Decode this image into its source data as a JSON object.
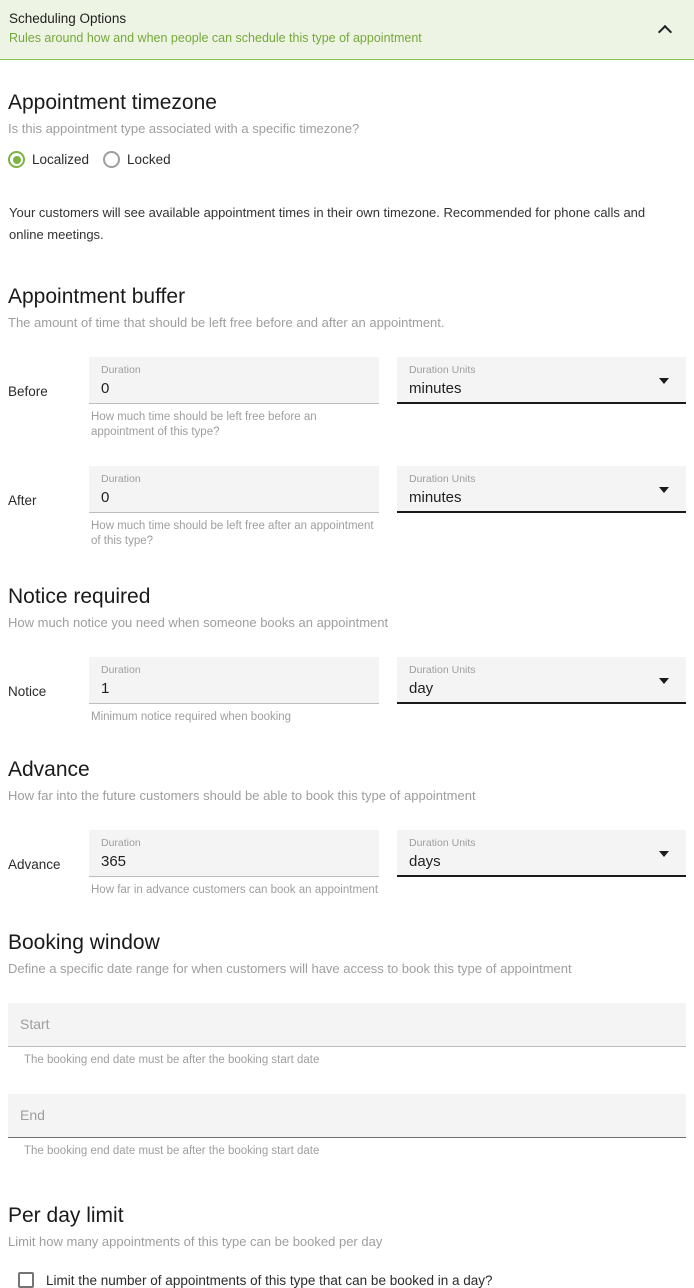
{
  "panel": {
    "title": "Scheduling Options",
    "subtitle": "Rules around how and when people can schedule this type of appointment",
    "collapse_icon": "chevron-up-icon",
    "accent_color": "#8bc34a",
    "header_bg": "#edf4e3",
    "subtitle_color": "#76a83c"
  },
  "timezone": {
    "title": "Appointment timezone",
    "description": "Is this appointment type associated with a specific timezone?",
    "options": [
      {
        "label": "Localized",
        "selected": true
      },
      {
        "label": "Locked",
        "selected": false
      }
    ],
    "explanation": "Your customers will see available appointment times in their own timezone. Recommended for phone calls and online meetings.",
    "selected_color": "#7cb342"
  },
  "buffer": {
    "title": "Appointment buffer",
    "description": "The amount of time that should be left free before and after an appointment.",
    "rows": [
      {
        "label": "Before",
        "duration_label": "Duration",
        "duration_value": "0",
        "units_label": "Duration Units",
        "units_value": "minutes",
        "hint": "How much time should be left free before an appointment of this type?"
      },
      {
        "label": "After",
        "duration_label": "Duration",
        "duration_value": "0",
        "units_label": "Duration Units",
        "units_value": "minutes",
        "hint": "How much time should be left free after an appointment of this type?"
      }
    ]
  },
  "notice": {
    "title": "Notice required",
    "description": "How much notice you need when someone books an appointment",
    "row": {
      "label": "Notice",
      "duration_label": "Duration",
      "duration_value": "1",
      "units_label": "Duration Units",
      "units_value": "day",
      "hint": "Minimum notice required when booking"
    }
  },
  "advance": {
    "title": "Advance",
    "description": "How far into the future customers should be able to book this type of appointment",
    "row": {
      "label": "Advance",
      "duration_label": "Duration",
      "duration_value": "365",
      "units_label": "Duration Units",
      "units_value": "days",
      "hint": "How far in advance customers can book an appointment"
    }
  },
  "booking_window": {
    "title": "Booking window",
    "description": "Define a specific date range for when customers will have access to book this type of appointment",
    "start": {
      "placeholder": "Start",
      "value": "",
      "hint": "The booking end date must be after the booking start date"
    },
    "end": {
      "placeholder": "End",
      "value": "",
      "hint": "The booking end date must be after the booking start date"
    }
  },
  "per_day_limit": {
    "title": "Per day limit",
    "description": "Limit how many appointments of this type can be booked per day",
    "checkbox_label": "Limit the number of appointments of this type that can be booked in a day?",
    "checked": false
  }
}
